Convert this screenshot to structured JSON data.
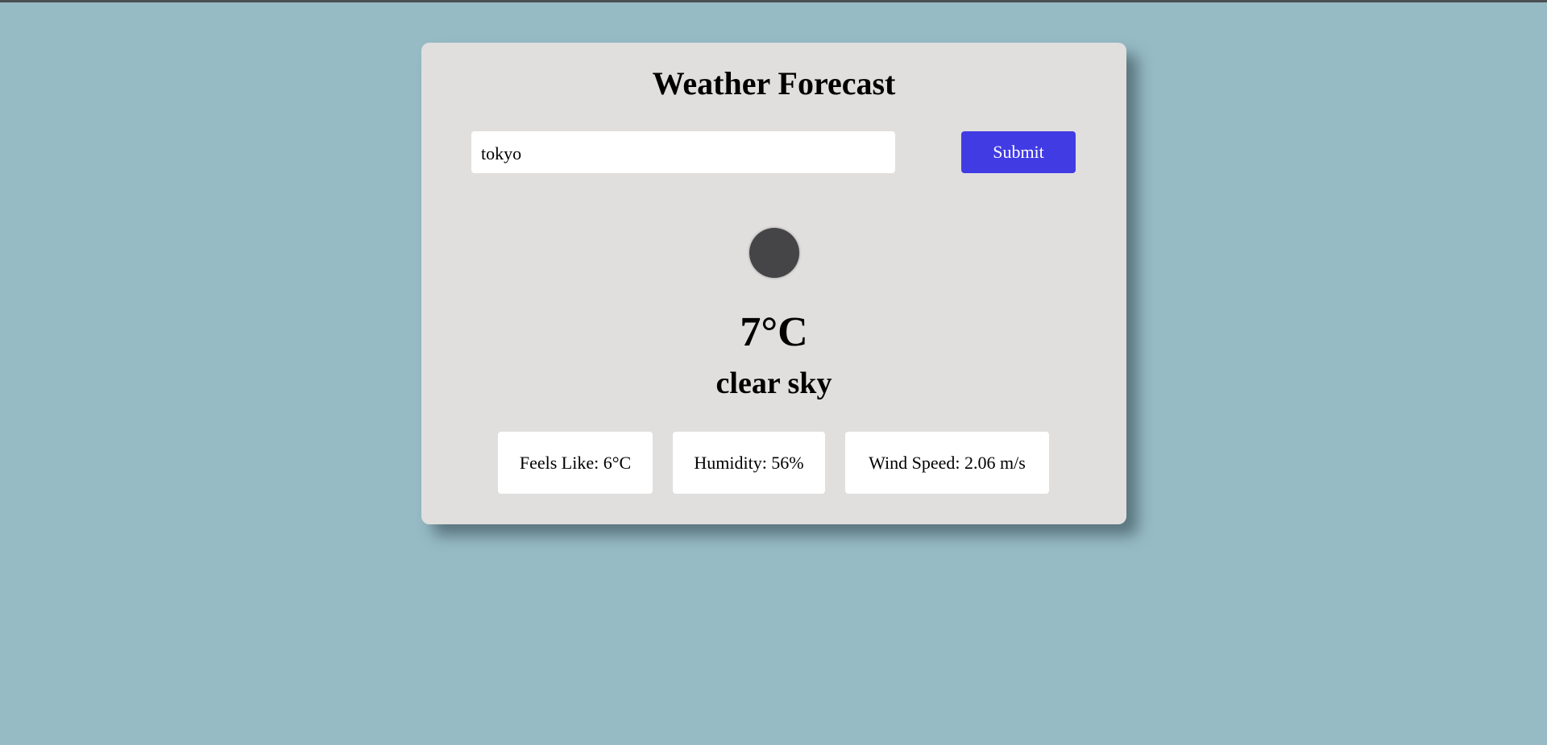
{
  "app": {
    "title": "Weather Forecast"
  },
  "search": {
    "value": "tokyo",
    "submit_label": "Submit"
  },
  "weather": {
    "icon": "weather-condition-icon",
    "temperature": "7°C",
    "description": "clear sky"
  },
  "stats": {
    "feels_like": "Feels Like: 6°C",
    "humidity": "Humidity: 56%",
    "wind_speed": "Wind Speed: 2.06 m/s"
  },
  "colors": {
    "background": "#97bbc5",
    "card": "#e0dfde",
    "accent": "#413be4"
  }
}
